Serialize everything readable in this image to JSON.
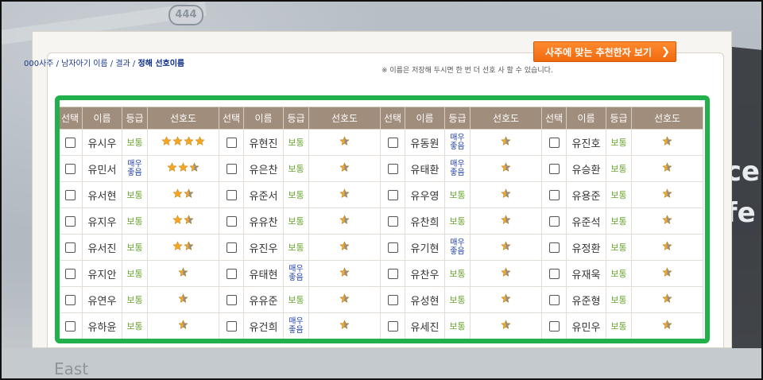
{
  "background": {
    "route_badge": "444",
    "street_text": "East",
    "side_text": "ce\nfe"
  },
  "header": {
    "breadcrumb_prefix": "000사주 / 남자아기 이름 / 결과 / ",
    "breadcrumb_bold": "정해 선호이름",
    "recommend_button": "사주에 맞는 추천한자 보기",
    "note": "※ 이름은 저장해 두시면 한 번 더 선호 사 할 수 있습니다."
  },
  "columns": [
    "선택",
    "이름",
    "등급",
    "선호도"
  ],
  "grade_labels": {
    "normal": "보통",
    "great": "매우좋음"
  },
  "rows": [
    [
      {
        "name": "유시우",
        "grade": "normal",
        "stars": 4
      },
      {
        "name": "유현진",
        "grade": "normal",
        "stars": 1
      },
      {
        "name": "유동원",
        "grade": "great",
        "stars": 1
      },
      {
        "name": "유진호",
        "grade": "normal",
        "stars": 1
      }
    ],
    [
      {
        "name": "유민서",
        "grade": "great",
        "stars": 3
      },
      {
        "name": "유은찬",
        "grade": "normal",
        "stars": 1
      },
      {
        "name": "유태환",
        "grade": "great",
        "stars": 1
      },
      {
        "name": "유승환",
        "grade": "normal",
        "stars": 1
      }
    ],
    [
      {
        "name": "유서현",
        "grade": "normal",
        "stars": 2
      },
      {
        "name": "유준서",
        "grade": "normal",
        "stars": 1
      },
      {
        "name": "유우영",
        "grade": "normal",
        "stars": 1
      },
      {
        "name": "유용준",
        "grade": "normal",
        "stars": 1
      }
    ],
    [
      {
        "name": "유지우",
        "grade": "normal",
        "stars": 2
      },
      {
        "name": "유유찬",
        "grade": "normal",
        "stars": 1
      },
      {
        "name": "유찬희",
        "grade": "normal",
        "stars": 1
      },
      {
        "name": "유준석",
        "grade": "normal",
        "stars": 1
      }
    ],
    [
      {
        "name": "유서진",
        "grade": "normal",
        "stars": 2
      },
      {
        "name": "유진우",
        "grade": "normal",
        "stars": 1
      },
      {
        "name": "유기현",
        "grade": "great",
        "stars": 1
      },
      {
        "name": "유정환",
        "grade": "normal",
        "stars": 1
      }
    ],
    [
      {
        "name": "유지안",
        "grade": "normal",
        "stars": 1
      },
      {
        "name": "유태현",
        "grade": "great",
        "stars": 1
      },
      {
        "name": "유찬우",
        "grade": "normal",
        "stars": 1
      },
      {
        "name": "유재욱",
        "grade": "normal",
        "stars": 1
      }
    ],
    [
      {
        "name": "유연우",
        "grade": "normal",
        "stars": 1
      },
      {
        "name": "유유준",
        "grade": "normal",
        "stars": 1
      },
      {
        "name": "유성현",
        "grade": "normal",
        "stars": 1
      },
      {
        "name": "유준형",
        "grade": "normal",
        "stars": 1
      }
    ],
    [
      {
        "name": "유하윤",
        "grade": "normal",
        "stars": 1
      },
      {
        "name": "유건희",
        "grade": "great",
        "stars": 1
      },
      {
        "name": "유세진",
        "grade": "normal",
        "stars": 1
      },
      {
        "name": "유민우",
        "grade": "normal",
        "stars": 1
      }
    ]
  ],
  "star_colors": {
    "full": "#f5a623",
    "partial_grey": "#8a8f99"
  }
}
